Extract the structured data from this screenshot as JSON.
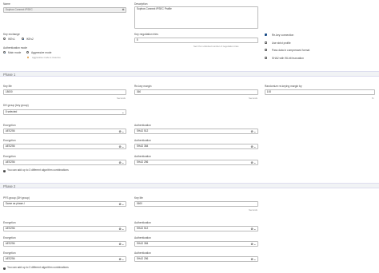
{
  "top": {
    "name_label": "Name",
    "name_value": "Sophos Connect IPSEC",
    "description_label": "Description",
    "description_value": "Sophos Connect IPSEC Profile",
    "key_exchange_label": "Key exchange",
    "key_exchange_options": [
      "IKEv1",
      "IKEv2"
    ],
    "key_exchange_selected": "IKEv2",
    "auth_mode_label": "Authentication mode",
    "auth_mode_options": [
      "Main mode",
      "Aggressive mode"
    ],
    "auth_mode_selected": "Main mode",
    "aggressive_warning": "Aggressive mode is insecure",
    "key_negotiation_label": "Key negotiation tries",
    "key_negotiation_value": "5",
    "key_negotiation_hint": "Set 0 for unlimited number of negotiation tries",
    "checkboxes": [
      {
        "label": "Re-key connection",
        "checked": true
      },
      {
        "label": "Use strict profile",
        "checked": false
      },
      {
        "label": "Pass data in compressed format",
        "checked": false
      },
      {
        "label": "SHA2 with 96-bit truncation",
        "checked": false
      }
    ]
  },
  "phase1": {
    "title": "Phase 1",
    "key_life_label": "Key life",
    "key_life_value": "18000",
    "key_life_unit": "Seconds",
    "rekey_margin_label": "Re-key margin",
    "rekey_margin_value": "360",
    "rekey_margin_unit": "Seconds",
    "randomize_label": "Randomize re-keying margin by",
    "randomize_value": "100",
    "randomize_unit": "%",
    "dh_label": "DH group (key group)",
    "dh_value": "8 selected",
    "pairs": [
      {
        "enc_label": "Encryption",
        "enc_value": "AES256",
        "auth_label": "Authentication",
        "auth_value": "SHA2 512"
      },
      {
        "enc_label": "Encryption",
        "enc_value": "AES256",
        "auth_label": "Authentication",
        "auth_value": "SHA2 384"
      },
      {
        "enc_label": "Encryption",
        "enc_value": "AES256",
        "auth_label": "Authentication",
        "auth_value": "SHA2 256"
      }
    ],
    "info": "You can add up to 3 different algorithm combinations"
  },
  "phase2": {
    "title": "Phase 2",
    "pfs_label": "PFS group (DH group)",
    "pfs_value": "Same as phase-I",
    "key_life_label": "Key life",
    "key_life_value": "3600",
    "key_life_unit": "Seconds",
    "pairs": [
      {
        "enc_label": "Encryption",
        "enc_value": "AES256",
        "auth_label": "Authentication",
        "auth_value": "SHA2 512"
      },
      {
        "enc_label": "Encryption",
        "enc_value": "AES256",
        "auth_label": "Authentication",
        "auth_value": "SHA2 384"
      },
      {
        "enc_label": "Encryption",
        "enc_value": "AES256",
        "auth_label": "Authentication",
        "auth_value": "SHA2 256"
      }
    ],
    "info": "You can add up to 3 different algorithm combinations"
  },
  "icons": {
    "clear": "x-circle-icon",
    "dropdown": "chevron-down-icon",
    "info": "info-icon",
    "warning": "warning-icon"
  },
  "colors": {
    "accent": "#1d4f8a",
    "warning": "#e08a1e",
    "section_bg": "#f1f3f5"
  }
}
